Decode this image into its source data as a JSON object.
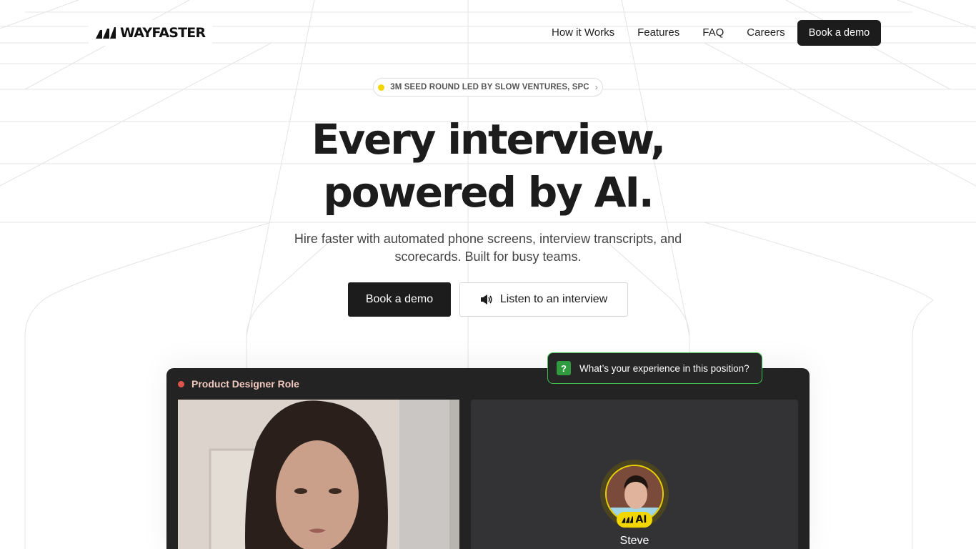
{
  "brand": {
    "name": "WAYFASTER",
    "logo_icon": "wayfaster-bars-icon"
  },
  "nav": {
    "links": [
      "How it Works",
      "Features",
      "FAQ",
      "Careers"
    ],
    "cta_label": "Book a demo"
  },
  "hero": {
    "badge": "3M SEED ROUND LED BY SLOW VENTURES, SPC",
    "badge_chevron": "›",
    "headline_line1": "Every interview,",
    "headline_line2": "powered by AI.",
    "subtitle": "Hire faster with automated phone screens, interview transcripts, and scorecards. Built for busy teams.",
    "primary_cta": "Book a demo",
    "secondary_cta": "Listen to an interview",
    "secondary_icon": "speaker-icon"
  },
  "demo": {
    "role_title": "Product Designer Role",
    "question_icon": "?",
    "question_text": "What’s your experience in this position?",
    "ai_label": "AI",
    "ai_name": "Steve"
  },
  "colors": {
    "dark": "#1c1c1c",
    "accent_yellow": "#f2d600",
    "accent_green": "#3fbf4f",
    "record_red": "#e0534a"
  }
}
